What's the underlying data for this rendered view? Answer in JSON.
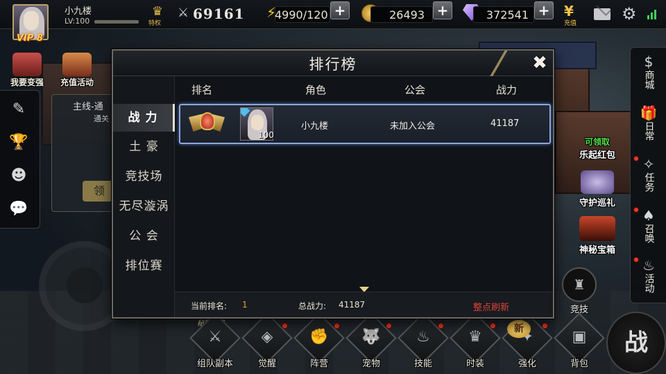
{
  "player": {
    "name": "小九楼",
    "level": "LV:100",
    "vip": "VIP 8",
    "tequan": "特权",
    "power": "69161"
  },
  "resources": {
    "energy": "4990/120",
    "coins": "26493",
    "gems": "372541",
    "recharge": "充值"
  },
  "left_shortcuts": [
    {
      "label": "我要变强"
    },
    {
      "label": "充值活动"
    }
  ],
  "quest_card": {
    "title": "主线-通",
    "subtitle": "通关",
    "button": "领"
  },
  "right_rail": [
    {
      "label": "商城",
      "icon": "dollar-bag-icon"
    },
    {
      "label": "日常",
      "icon": "gift-icon"
    },
    {
      "label": "任务",
      "icon": "scroll-icon"
    },
    {
      "label": "召唤",
      "icon": "summon-icon"
    },
    {
      "label": "活动",
      "icon": "bell-icon"
    }
  ],
  "events": [
    {
      "tag": "可领取",
      "label": "乐起红包"
    },
    {
      "label": "守护巡礼"
    },
    {
      "label": "神秘宝箱"
    }
  ],
  "arena": {
    "label": "竞技"
  },
  "bottom_nav": [
    {
      "label": "组队副本",
      "glyph": "⚔"
    },
    {
      "label": "觉醒",
      "glyph": "◈"
    },
    {
      "label": "阵营",
      "glyph": "✊"
    },
    {
      "label": "宠物",
      "glyph": "🐺"
    },
    {
      "label": "技能",
      "glyph": "♨"
    },
    {
      "label": "时装",
      "glyph": "♛"
    },
    {
      "label": "强化",
      "glyph": "✦"
    },
    {
      "label": "背包",
      "glyph": "▣"
    }
  ],
  "upgrade_tag": "秘籍升级",
  "new_badge": "新",
  "battle_button": "战",
  "ranking": {
    "title": "排行榜",
    "close": "✖",
    "tabs": [
      "战 力",
      "土 豪",
      "竞技场",
      "无尽漩涡",
      "公 会",
      "排位赛"
    ],
    "active_tab": 0,
    "columns": {
      "rank": "排名",
      "role": "角色",
      "guild": "公会",
      "power": "战力"
    },
    "rows": [
      {
        "level": "100",
        "name": "小九楼",
        "guild": "未加入公会",
        "power": "41187"
      }
    ],
    "footer": {
      "current_rank_label": "当前排名:",
      "current_rank": "1",
      "total_power_label": "总战力:",
      "total_power": "41187",
      "refresh": "整点刷新"
    }
  },
  "colors": {
    "accent_gold": "#e3b84a",
    "refresh_red": "#e0433a",
    "row_highlight": "#8fa7d8"
  }
}
